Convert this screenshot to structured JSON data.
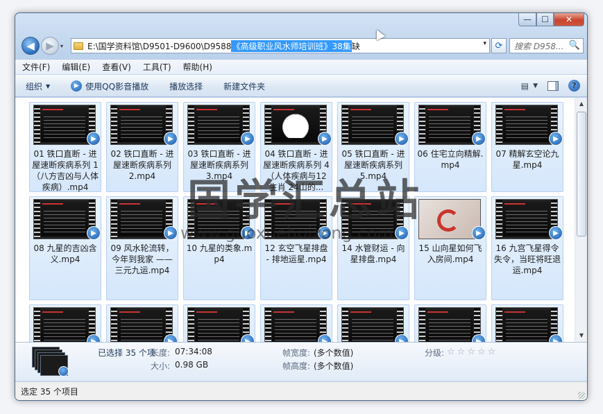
{
  "window": {
    "min": "—",
    "max": "☐",
    "close": "✕"
  },
  "nav": {
    "back": "◀",
    "forward": "▶",
    "dropdown": "▾"
  },
  "address": {
    "path_prefix": "E:\\国学资料馆\\D9501-D9600\\D9588",
    "path_selected": "《高级职业风水师培训班》38集",
    "path_suffix": " 缺",
    "dropdown": "▾"
  },
  "search": {
    "placeholder": "搜索 D958...",
    "icon": "🔍"
  },
  "menu": [
    "文件(F)",
    "编辑(E)",
    "查看(V)",
    "工具(T)",
    "帮助(H)"
  ],
  "toolbar": {
    "organize": "组织",
    "play_qq": "使用QQ影音播放",
    "play_select": "播放选择",
    "new_folder": "新建文件夹",
    "help": "?"
  },
  "files": [
    {
      "name": "01 铁口直断 - 进屋速断疾病系列 1 （八方吉凶与人体疾病）.mp4",
      "thumb": "text"
    },
    {
      "name": "02 铁口直断 - 进屋速断疾病系列 2.mp4",
      "thumb": "chart"
    },
    {
      "name": "03 铁口直断 - 进屋速断疾病系列 3.mp4",
      "thumb": "text"
    },
    {
      "name": "04 铁口直断 - 进屋速断疾病系列 4 （人体疾病与12生肖 24山的...",
      "thumb": "disc"
    },
    {
      "name": "05 铁口直断 - 进屋速断疾病系列 5.mp4",
      "thumb": "text"
    },
    {
      "name": "06 住宅立向精解.mp4",
      "thumb": "text"
    },
    {
      "name": "07 精解玄空论九星.mp4",
      "thumb": "text"
    },
    {
      "name": "08 九星的吉凶含义.mp4",
      "thumb": "text"
    },
    {
      "name": "09 风水轮流转，今年到我家 —— 三元九运.mp4",
      "thumb": "text"
    },
    {
      "name": "10 九星的类象.mp4",
      "thumb": "text"
    },
    {
      "name": "12 玄空飞星排盘 - 排地运星.mp4",
      "thumb": "chart"
    },
    {
      "name": "14 水管财运 - 向星排盘.mp4",
      "thumb": "chart"
    },
    {
      "name": "15 山向星如何飞入房间.mp4",
      "thumb": "photo"
    },
    {
      "name": "16 九宫飞星得令失令，当旺将旺退运.mp4",
      "thumb": "text"
    },
    {
      "name": "",
      "thumb": "chart"
    },
    {
      "name": "",
      "thumb": "text"
    },
    {
      "name": "",
      "thumb": "chart"
    },
    {
      "name": "",
      "thumb": "chart"
    },
    {
      "name": "",
      "thumb": "text"
    },
    {
      "name": "",
      "thumb": "text"
    },
    {
      "name": "",
      "thumb": "chart"
    }
  ],
  "details": {
    "selected": "已选择 35 个项",
    "length_label": "长度:",
    "length": "07:34:08",
    "size_label": "大小:",
    "size": "0.98 GB",
    "width_label": "帧宽度:",
    "width": "(多个数值)",
    "height_label": "帧高度:",
    "height": "(多个数值)",
    "rating_label": "分级:",
    "stars": "☆☆☆☆☆"
  },
  "status": {
    "text": "选定 35 个项目"
  },
  "watermark": {
    "title": "国学汇总站",
    "url": "www.guoxuehuizong.com"
  }
}
